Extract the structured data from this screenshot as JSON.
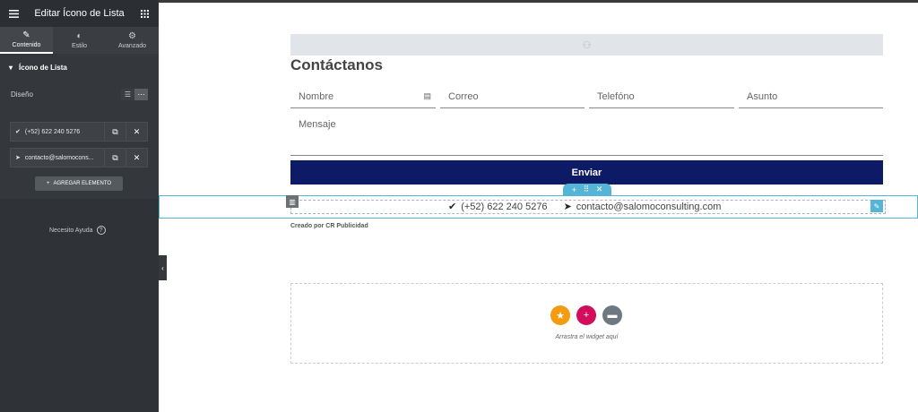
{
  "sidebar": {
    "title": "Editar Ícono de Lista",
    "tabs": [
      {
        "label": "Contenido",
        "icon": "pencil-icon"
      },
      {
        "label": "Estilo",
        "icon": "contrast-icon"
      },
      {
        "label": "Avanzado",
        "icon": "gear-icon"
      }
    ],
    "section_title": "Ícono de Lista",
    "design_label": "Diseño",
    "items": [
      {
        "label": "(+52) 622 240 5276",
        "icon": "check-icon"
      },
      {
        "label": "contacto@salomocons...",
        "icon": "paper-plane-icon"
      }
    ],
    "add_button": "AGREGAR ELEMENTO",
    "help": "Necesito Ayuda"
  },
  "canvas": {
    "heading": "Contáctanos",
    "fields": {
      "name": "Nombre",
      "email": "Correo",
      "phone": "Telefóno",
      "subject": "Asunto",
      "message": "Mensaje"
    },
    "send_button": "Enviar",
    "contact_phone": "(+52) 622 240 5276",
    "contact_email": "contacto@salomoconsulting.com",
    "credit": "Creado por CR Publicidad",
    "drop_text": "Arrastra el widget aquí"
  },
  "colors": {
    "sidebar_bg": "#34383c",
    "send_button_bg": "#0d1a66",
    "accent_blue": "#55b5d6",
    "star_button": "#f39c12",
    "add_button": "#d30c5c",
    "folder_button": "#6d7882"
  }
}
